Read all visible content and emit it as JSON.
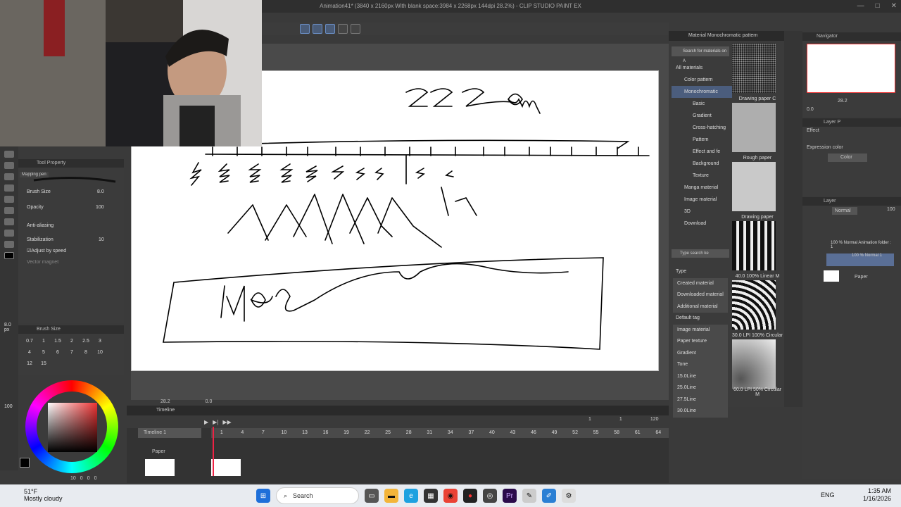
{
  "window": {
    "title": "Animation41* (3840 x 2160px With blank space:3984 x 2268px 144dpi 28.2%) - CLIP STUDIO PAINT EX",
    "controls": [
      "—",
      "□",
      "✕"
    ]
  },
  "tool_property": {
    "header": "Tool Property",
    "tool": "Mapping pen",
    "brush_size_label": "Brush Size",
    "brush_size_value": "8.0",
    "opacity_label": "Opacity",
    "opacity_value": "100",
    "antialias_label": "Anti-aliasing",
    "stabilization_label": "Stabilization",
    "stabilization_value": "10",
    "adjust_label": "Adjust by speed",
    "vector_label": "Vector magnet"
  },
  "brush_size_panel": {
    "header": "Brush Size",
    "current": "8.0",
    "unit": "px",
    "sizes": [
      "0.7",
      "1",
      "1.5",
      "2",
      "2.5",
      "3",
      "4",
      "5",
      "6",
      "7",
      "8",
      "10",
      "12",
      "15"
    ]
  },
  "color": {
    "opacity": "100",
    "bottom_values": [
      "10",
      "0",
      "0",
      "0"
    ]
  },
  "canvas_text": {
    "top_note": "22 am",
    "bottom_note": "Wave"
  },
  "timeline": {
    "header": "Timeline",
    "name": "Timeline 1",
    "frames": [
      "1",
      "4",
      "7",
      "10",
      "13",
      "16",
      "19",
      "22",
      "25",
      "28",
      "31",
      "34",
      "37",
      "40",
      "43",
      "46",
      "49",
      "52",
      "55",
      "58",
      "61",
      "64"
    ],
    "counter_left": "1",
    "counter_mid": "1",
    "counter_end": "120",
    "track": "Paper",
    "zoom": "28.2",
    "rotation": "0.0"
  },
  "material_panel": {
    "header": "Material Monochromatic pattern",
    "search": "Search for materials on A",
    "tree": [
      "All materials",
      "Color pattern",
      "Monochromatic",
      "Basic",
      "Gradient",
      "Cross-hatching",
      "Pattern",
      "Effect and fe",
      "Background",
      "Texture",
      "Manga material",
      "Image material",
      "3D",
      "Download"
    ],
    "selected": "Monochromatic",
    "tag_search": "Type search ke",
    "type_header": "Type",
    "types": [
      "Created material",
      "Downloaded material",
      "Additional material"
    ],
    "default_tag_header": "Default tag",
    "tags": [
      "Image material",
      "Paper texture",
      "Gradient",
      "Tone",
      "15.0Line",
      "25.0Line",
      "27.5Line",
      "30.0Line"
    ],
    "thumbs": [
      "Drawing paper C",
      "Rough paper",
      "Drawing paper",
      "40.0 100% Linear M",
      "30.0 LPI 100% Circular",
      "60.0 LPI 50% Circular M"
    ]
  },
  "navigator": {
    "header": "Navigator",
    "zoom": "28.2",
    "rotation": "0.0"
  },
  "layer_property": {
    "header": "Layer P",
    "effect": "Effect",
    "expression_label": "Expression color",
    "expression_value": "Color"
  },
  "layers": {
    "header": "Layer",
    "blend": "Normal",
    "opacity": "100",
    "items": [
      {
        "name": "100 % Normal Animation folder : 1"
      },
      {
        "name": "100 % Normal 1"
      },
      {
        "name": "Paper"
      }
    ]
  },
  "taskbar": {
    "weather_temp": "51°F",
    "weather_desc": "Mostly cloudy",
    "search": "Search",
    "lang": "ENG",
    "time": "1:35 AM",
    "date": "1/16/2026"
  }
}
